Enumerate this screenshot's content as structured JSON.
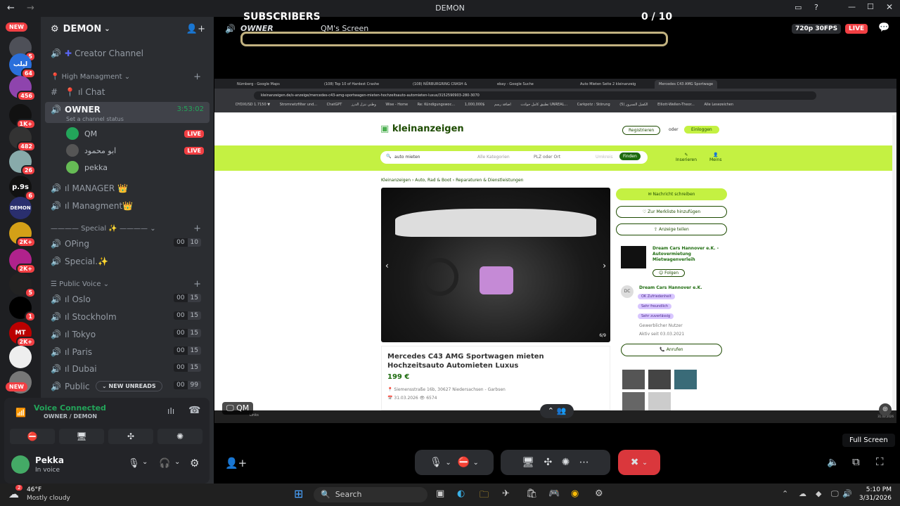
{
  "window": {
    "title": "DEMON"
  },
  "servers": [
    {
      "label": "NEW",
      "badge": ""
    },
    {
      "label": "",
      "badge": "5"
    },
    {
      "label": "ليلب",
      "badge": "64"
    },
    {
      "label": "",
      "badge": "456"
    },
    {
      "label": "",
      "badge": "1K+"
    },
    {
      "label": "",
      "badge": "482"
    },
    {
      "label": "",
      "badge": "26"
    },
    {
      "label": "p.9s",
      "badge": "6"
    },
    {
      "label": "DEMON",
      "badge": ""
    },
    {
      "label": "",
      "badge": "2K+"
    },
    {
      "label": "",
      "badge": "2K+"
    },
    {
      "label": "",
      "badge": "5"
    },
    {
      "label": "",
      "badge": "1"
    },
    {
      "label": "MT",
      "badge": "2K+"
    },
    {
      "label": "",
      "badge": ""
    },
    {
      "label": "NEW",
      "badge": ""
    }
  ],
  "guild": {
    "name": "DEMON"
  },
  "channels": {
    "creator": "Creator Channel",
    "high_cat": "High Managment",
    "chat": "ıl Chat",
    "owner": "OWNER",
    "owner_time": "3:53:02",
    "status_placeholder": "Set a channel status",
    "voice_users": [
      {
        "name": "QM",
        "live": "LIVE"
      },
      {
        "name": "ابو محمود",
        "live": "LIVE"
      },
      {
        "name": "pekka",
        "live": ""
      }
    ],
    "manager": "ıl MANAGER 👑",
    "managment": "ıl Managment👑",
    "special_cat": "———— Special ✨ ————",
    "oping": "OPing",
    "oping_cnt": [
      "00",
      "10"
    ],
    "special": "Special.✨",
    "public_cat": "Public Voice",
    "public": [
      {
        "name": "ıl Oslo",
        "cnt": [
          "00",
          "15"
        ]
      },
      {
        "name": "ıl Stockholm",
        "cnt": [
          "00",
          "15"
        ]
      },
      {
        "name": "ıl Tokyo",
        "cnt": [
          "00",
          "15"
        ]
      },
      {
        "name": "ıl Paris",
        "cnt": [
          "00",
          "15"
        ]
      },
      {
        "name": "ıl Dubai",
        "cnt": [
          "00",
          "15"
        ]
      },
      {
        "name": "Public",
        "cnt": [
          "00",
          "99"
        ]
      }
    ],
    "new_unreads": "NEW UNREADS"
  },
  "voice": {
    "status": "Voice Connected",
    "location": "OWNER / DEMON"
  },
  "user": {
    "name": "Pekka",
    "status": "In voice"
  },
  "stream": {
    "subscribers_label": "SUBSCRIBERS",
    "counter": "0 / 10",
    "channel": "OWNER",
    "screen_label": "QM's Screen",
    "quality": "720p 30FPS",
    "live": "LIVE",
    "streamer_tag": "QM",
    "full_screen": "Full Screen"
  },
  "browser": {
    "tabs": [
      "Nürnberg - Google Maps",
      "(108) Top 10 of Hardest Crashe",
      "(108) NÜRBURGRING CRASH &",
      "ebay - Google Suche",
      "Auto Mieten Seite 2 kleinanzeig",
      "Mercedes C43 AMG Sportwage"
    ],
    "url": "kleinanzeigen.de/s-anzeige/mercedes-c43-amg-sportwagen-mieten-hochzeitsauto-automieten-luxus/3152590903-280-3070",
    "bookmarks": [
      "DYDXUSD 1.7150 ▼",
      "Stromnetzfilter und...",
      "ChatGPT",
      "وطني ننزل الدرز",
      "Wise - Home",
      "Re: Kündigungswoc...",
      "تطبيق كامل حوادث",
      "اضافة رسم",
      "$1,000,000 UNREAL...",
      "Carkpotz : Störung",
      "الكفيل التسرور (5)",
      "Elliott-Wellen-Theor...",
      "Alle Lesezeichen"
    ]
  },
  "site": {
    "logo": "kleinanzeigen",
    "register": "Registrieren",
    "or": "oder",
    "login": "Einloggen",
    "search_value": "auto mieten",
    "category": "Alle Kategorien",
    "location_placeholder": "PLZ oder Ort",
    "radius": "Umkreis",
    "find": "Finden",
    "insert": "Inserieren",
    "mine": "Meins",
    "breadcrumbs": [
      "Kleinanzeigen",
      "Auto, Rad & Boot",
      "Reparaturen & Dienstleistungen"
    ],
    "photo_counter": "6/9",
    "ad_title": "Mercedes C43 AMG Sportwagen mieten Hochzeitsauto Automieten Luxus",
    "price": "199 €",
    "address": "Siemensstraße 16b, 30627 Niedersachsen - Garbsen",
    "date": "31.03.2026",
    "views": "6574",
    "message_btn": "Nachricht schreiben",
    "watchlist_btn": "Zur Merkliste hinzufügen",
    "share_btn": "Anzeige teilen",
    "dealer": "Dream Cars Hannover e.K. - Autovermietung Mietwagenverleih",
    "follow": "Folgen",
    "seller_initials": "DC",
    "seller": "Dream Cars Hannover e.K.",
    "tags": [
      "OK Zufriedenheit",
      "Sehr freundlich",
      "Sehr zuverlässig"
    ],
    "seller_type": "Gewerblicher Nutzer",
    "active_since": "Aktiv seit 03.03.2021",
    "call": "Anrufen"
  },
  "inner_taskbar": {
    "search": "Links",
    "time": "31.03.2026"
  },
  "taskbar": {
    "weather_temp": "46°F",
    "weather_desc": "Mostly cloudy",
    "search": "Search",
    "time": "5:10 PM",
    "date": "3/31/2026",
    "weather_badge": "2"
  },
  "colors": {
    "live": "#f23f43",
    "green": "#23a55a",
    "brand": "#5865f2",
    "kleinanzeigen": "#c4f142",
    "hangup": "#da373c"
  }
}
